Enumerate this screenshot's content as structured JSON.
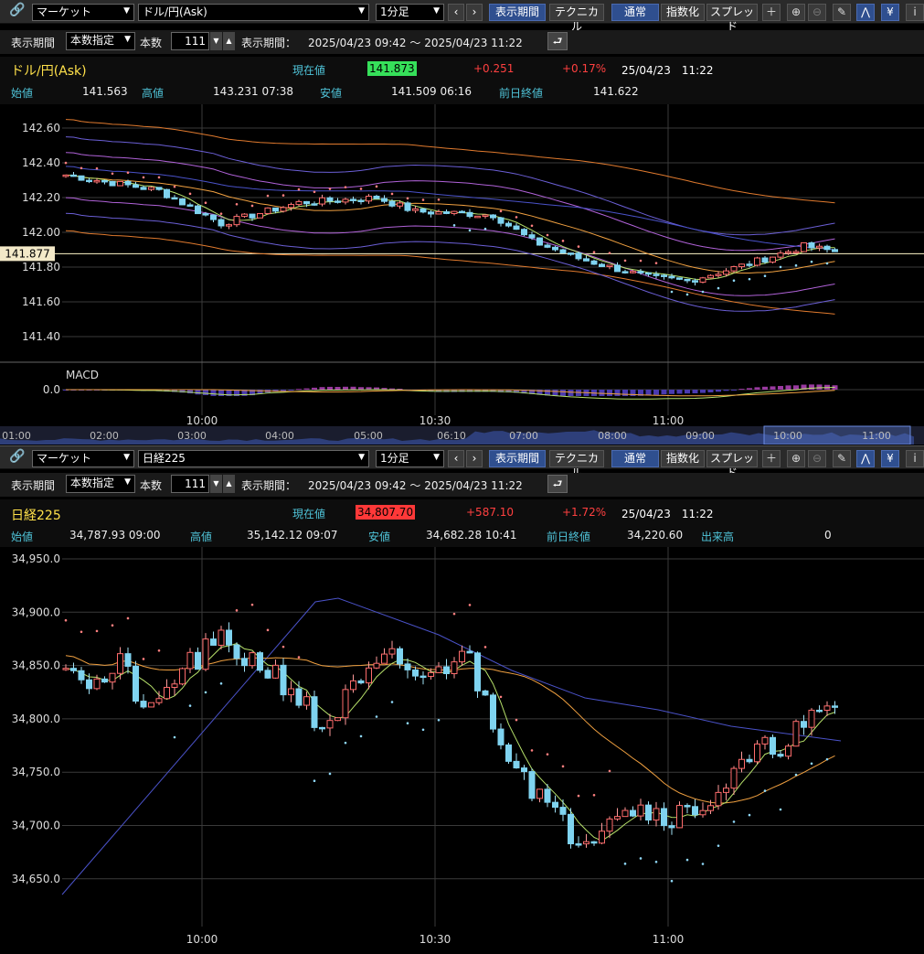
{
  "top": {
    "market_select": "マーケット",
    "symbol_select": "ドル/円(Ask)",
    "interval_select": "1分足",
    "buttons": {
      "prev": "‹",
      "next": "›",
      "period": "表示期間",
      "technical": "テクニカル",
      "normal": "通常",
      "index": "指数化",
      "spread": "スプレッド"
    },
    "period_label": "表示期間",
    "period_mode": "本数指定",
    "count_label": "本数",
    "count_value": "111",
    "range_label": "表示期間：",
    "range_value": "2025/04/23 09:42 ～ 2025/04/23 11:22",
    "title": "ドル/円(Ask)",
    "now_label": "現在値",
    "now_value": "141.873",
    "change": "+0.251",
    "change_pct": "+0.17%",
    "datetime": "25/04/23　11:22",
    "open_label": "始値",
    "open_value": "141.563",
    "high_label": "高値",
    "high_value": "143.231 07:38",
    "low_label": "安値",
    "low_value": "141.509 06:16",
    "prev_label": "前日終値",
    "prev_value": "141.622",
    "y_ticks": [
      "142.60",
      "142.40",
      "142.20",
      "142.00",
      "141.80",
      "141.60",
      "141.40"
    ],
    "price_tag": "141.877",
    "macd_label": "MACD",
    "macd_zero": "0.0",
    "x_ticks": [
      "10:00",
      "10:30",
      "11:00"
    ],
    "nav_ticks": [
      "01:00",
      "02:00",
      "03:00",
      "04:00",
      "05:00",
      "06:10",
      "07:00",
      "08:00",
      "09:00",
      "10:00",
      "11:00"
    ]
  },
  "bottom": {
    "market_select": "マーケット",
    "symbol_select": "日経225",
    "interval_select": "1分足",
    "buttons": {
      "prev": "‹",
      "next": "›",
      "period": "表示期間",
      "technical": "テクニカル",
      "normal": "通常",
      "index": "指数化",
      "spread": "スプレッド"
    },
    "period_label": "表示期間",
    "period_mode": "本数指定",
    "count_label": "本数",
    "count_value": "111",
    "range_label": "表示期間：",
    "range_value": "2025/04/23 09:42 ～ 2025/04/23 11:22",
    "title": "日経225",
    "now_label": "現在値",
    "now_value": "34,807.70",
    "change": "+587.10",
    "change_pct": "+1.72%",
    "datetime": "25/04/23　11:22",
    "open_label": "始値",
    "open_value": "34,787.93 09:00",
    "high_label": "高値",
    "high_value": "35,142.12 09:07",
    "low_label": "安値",
    "low_value": "34,682.28 10:41",
    "prev_label": "前日終値",
    "prev_value": "34,220.60",
    "volume_label": "出来高",
    "volume_value": "0",
    "y_ticks": [
      "34,950.0",
      "34,900.0",
      "34,850.0",
      "34,800.0",
      "34,750.0",
      "34,700.0",
      "34,650.0"
    ],
    "x_ticks": [
      "10:00",
      "10:30",
      "11:00"
    ]
  },
  "icons": [
    "link-icon",
    "plus-icon",
    "zoom-in-icon",
    "zoom-out-icon",
    "pencil-icon",
    "cursor-chart-icon",
    "yen-icon",
    "info-icon",
    "reset-icon"
  ],
  "colors": {
    "up_candle": "#ff6b6b",
    "down_candle": "#7fd3f0",
    "price_box_green": "#36e05a",
    "price_box_red": "#ff3838",
    "label_teal": "#4fc3d8",
    "title_yellow": "#ffe14a"
  }
}
